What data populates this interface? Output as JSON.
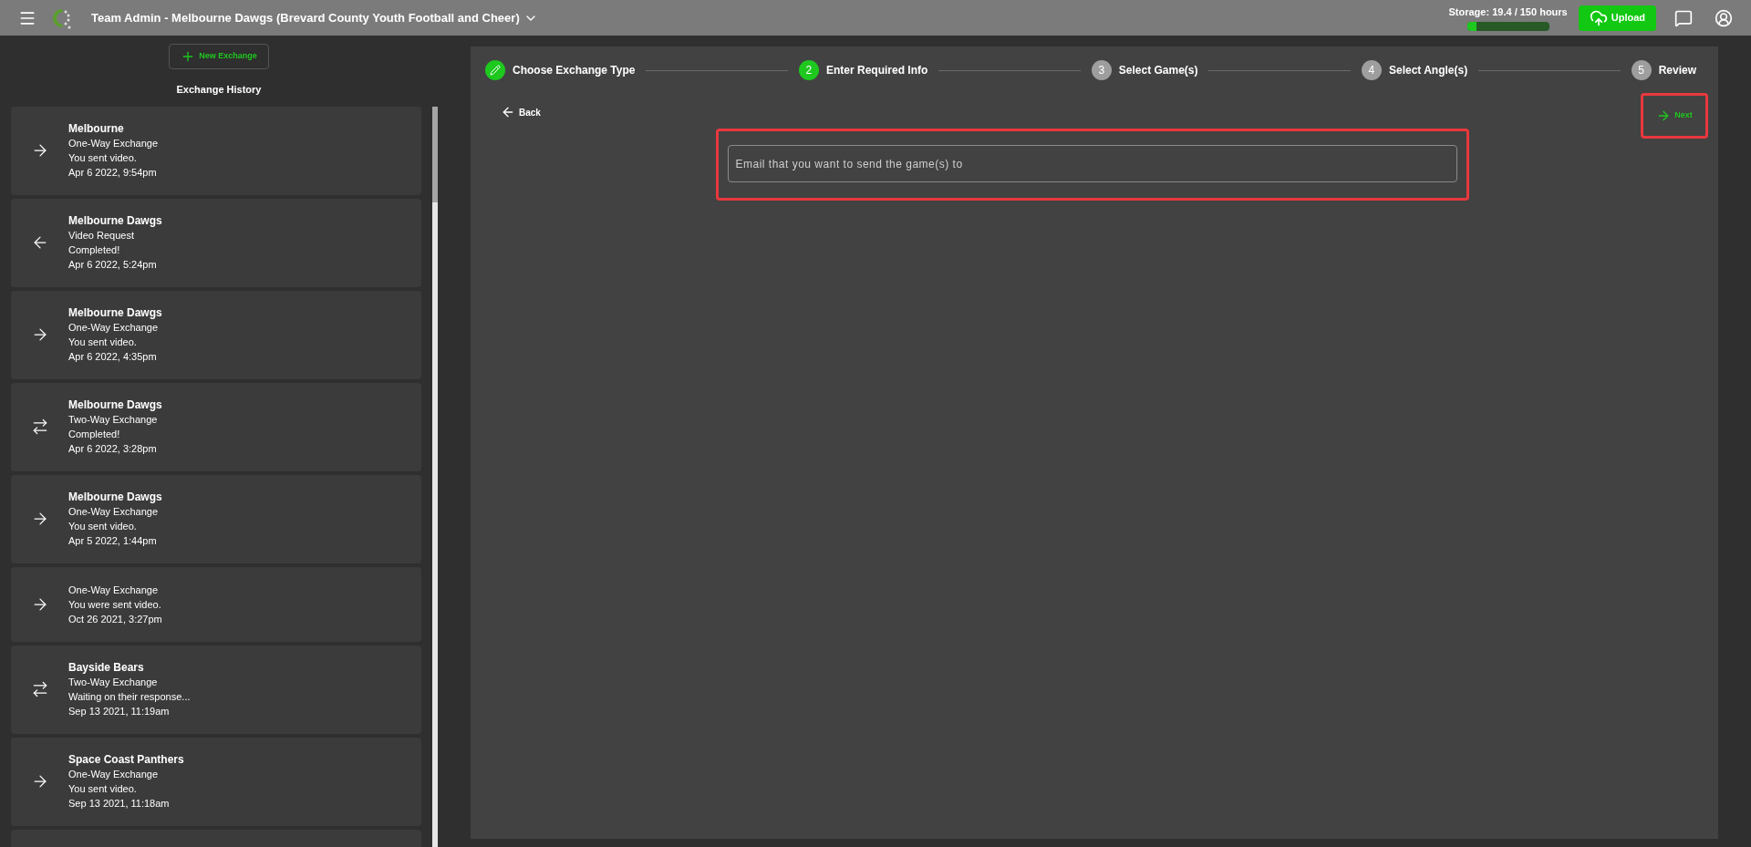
{
  "top_bar": {
    "title": "Team Admin - Melbourne Dawgs (Brevard County Youth Football and Cheer)",
    "storage": {
      "label": "Storage: 19.4 / 150 hours",
      "level": 0.12
    },
    "upload_button": "Upload"
  },
  "sidebar": {
    "new_button": "New Exchange",
    "heading": "Exchange History",
    "items": [
      {
        "kind": "outgoing",
        "team": "Melbourne",
        "type": "One-Way Exchange",
        "status": "You sent video.",
        "date": "Apr 6 2022, 9:54pm"
      },
      {
        "kind": "incoming",
        "team": "Melbourne Dawgs",
        "type": "Video Request",
        "status": "Completed!",
        "date": "Apr 6 2022, 5:24pm"
      },
      {
        "kind": "outgoing",
        "team": "Melbourne Dawgs",
        "type": "One-Way Exchange",
        "status": "You sent video.",
        "date": "Apr 6 2022, 4:35pm"
      },
      {
        "kind": "two-way",
        "team": "Melbourne Dawgs",
        "type": "Two-Way Exchange",
        "status": "Completed!",
        "date": "Apr 6 2022, 3:28pm"
      },
      {
        "kind": "outgoing",
        "team": "Melbourne Dawgs",
        "type": "One-Way Exchange",
        "status": "You sent video.",
        "date": "Apr 5 2022, 1:44pm"
      },
      {
        "kind": "outgoing",
        "type": "One-Way Exchange",
        "status": "You were sent video.",
        "date": "Oct 26 2021, 3:27pm"
      },
      {
        "kind": "two-way",
        "team": "Bayside Bears",
        "type": "Two-Way Exchange",
        "status": "Waiting on their response...",
        "date": "Sep 13 2021, 11:19am"
      },
      {
        "kind": "outgoing",
        "team": "Space Coast Panthers",
        "type": "One-Way Exchange",
        "status": "You sent video.",
        "date": "Sep 13 2021, 11:18am"
      }
    ]
  },
  "stepper": [
    {
      "kind": "completed",
      "label": "Choose Exchange Type"
    },
    {
      "kind": "current",
      "number": "2",
      "label": "Enter Required Info"
    },
    {
      "kind": "upcoming",
      "number": "3",
      "label": "Select Game(s)"
    },
    {
      "kind": "upcoming",
      "number": "4",
      "label": "Select Angle(s)"
    },
    {
      "kind": "upcoming",
      "number": "5",
      "label": "Review"
    }
  ],
  "back_button": "Back",
  "next_button": {
    "label": "Next",
    "highlighted": true
  },
  "email_field": {
    "placeholder": "Email that you want to send the game(s) to",
    "highlighted": true
  }
}
